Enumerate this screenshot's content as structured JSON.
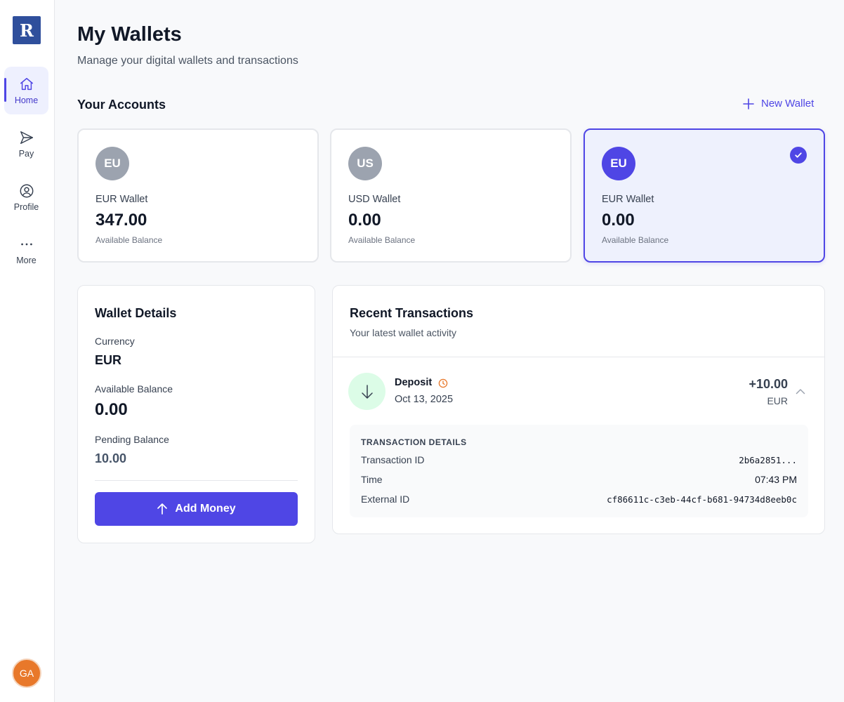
{
  "sidebar": {
    "logo_letter": "R",
    "items": [
      {
        "label": "Home",
        "icon": "home-icon",
        "active": true
      },
      {
        "label": "Pay",
        "icon": "send-icon",
        "active": false
      },
      {
        "label": "Profile",
        "icon": "user-circle-icon",
        "active": false
      },
      {
        "label": "More",
        "icon": "more-horizontal-icon",
        "active": false
      }
    ],
    "avatar_initials": "GA"
  },
  "header": {
    "title": "My Wallets",
    "subtitle": "Manage your digital wallets and transactions"
  },
  "accounts": {
    "section_title": "Your Accounts",
    "new_wallet_label": "New Wallet",
    "wallets": [
      {
        "badge": "EU",
        "name": "EUR Wallet",
        "amount": "347.00",
        "label": "Available Balance",
        "selected": false
      },
      {
        "badge": "US",
        "name": "USD Wallet",
        "amount": "0.00",
        "label": "Available Balance",
        "selected": false
      },
      {
        "badge": "EU",
        "name": "EUR Wallet",
        "amount": "0.00",
        "label": "Available Balance",
        "selected": true
      }
    ]
  },
  "wallet_details": {
    "title": "Wallet Details",
    "currency_label": "Currency",
    "currency_value": "EUR",
    "available_label": "Available Balance",
    "available_value": "0.00",
    "pending_label": "Pending Balance",
    "pending_value": "10.00",
    "add_money_label": "Add Money"
  },
  "transactions": {
    "title": "Recent Transactions",
    "subtitle": "Your latest wallet activity",
    "items": [
      {
        "type": "Deposit",
        "date": "Oct 13, 2025",
        "amount": "+10.00",
        "currency": "EUR",
        "details": {
          "heading": "TRANSACTION DETAILS",
          "id_label": "Transaction ID",
          "id_value": "2b6a2851...",
          "time_label": "Time",
          "time_value": "07:43 PM",
          "external_label": "External ID",
          "external_value": "cf86611c-c3eb-44cf-b681-94734d8eeb0c"
        }
      }
    ]
  },
  "colors": {
    "accent": "#4f46e5",
    "deposit_bg": "#dcfce7",
    "pending_clock": "#e8782a",
    "avatar": "#e8782a"
  }
}
